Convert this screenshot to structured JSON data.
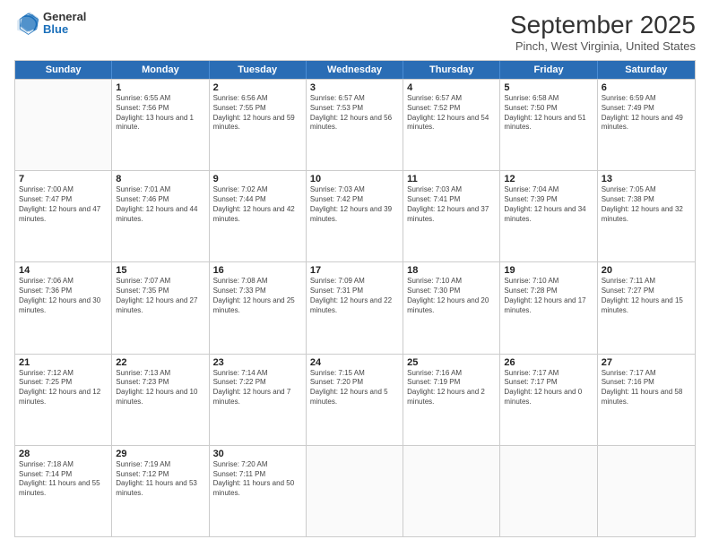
{
  "logo": {
    "general": "General",
    "blue": "Blue"
  },
  "title": "September 2025",
  "location": "Pinch, West Virginia, United States",
  "days": [
    "Sunday",
    "Monday",
    "Tuesday",
    "Wednesday",
    "Thursday",
    "Friday",
    "Saturday"
  ],
  "weeks": [
    [
      {
        "day": "",
        "sunrise": "",
        "sunset": "",
        "daylight": ""
      },
      {
        "day": "1",
        "sunrise": "Sunrise: 6:55 AM",
        "sunset": "Sunset: 7:56 PM",
        "daylight": "Daylight: 13 hours and 1 minute."
      },
      {
        "day": "2",
        "sunrise": "Sunrise: 6:56 AM",
        "sunset": "Sunset: 7:55 PM",
        "daylight": "Daylight: 12 hours and 59 minutes."
      },
      {
        "day": "3",
        "sunrise": "Sunrise: 6:57 AM",
        "sunset": "Sunset: 7:53 PM",
        "daylight": "Daylight: 12 hours and 56 minutes."
      },
      {
        "day": "4",
        "sunrise": "Sunrise: 6:57 AM",
        "sunset": "Sunset: 7:52 PM",
        "daylight": "Daylight: 12 hours and 54 minutes."
      },
      {
        "day": "5",
        "sunrise": "Sunrise: 6:58 AM",
        "sunset": "Sunset: 7:50 PM",
        "daylight": "Daylight: 12 hours and 51 minutes."
      },
      {
        "day": "6",
        "sunrise": "Sunrise: 6:59 AM",
        "sunset": "Sunset: 7:49 PM",
        "daylight": "Daylight: 12 hours and 49 minutes."
      }
    ],
    [
      {
        "day": "7",
        "sunrise": "Sunrise: 7:00 AM",
        "sunset": "Sunset: 7:47 PM",
        "daylight": "Daylight: 12 hours and 47 minutes."
      },
      {
        "day": "8",
        "sunrise": "Sunrise: 7:01 AM",
        "sunset": "Sunset: 7:46 PM",
        "daylight": "Daylight: 12 hours and 44 minutes."
      },
      {
        "day": "9",
        "sunrise": "Sunrise: 7:02 AM",
        "sunset": "Sunset: 7:44 PM",
        "daylight": "Daylight: 12 hours and 42 minutes."
      },
      {
        "day": "10",
        "sunrise": "Sunrise: 7:03 AM",
        "sunset": "Sunset: 7:42 PM",
        "daylight": "Daylight: 12 hours and 39 minutes."
      },
      {
        "day": "11",
        "sunrise": "Sunrise: 7:03 AM",
        "sunset": "Sunset: 7:41 PM",
        "daylight": "Daylight: 12 hours and 37 minutes."
      },
      {
        "day": "12",
        "sunrise": "Sunrise: 7:04 AM",
        "sunset": "Sunset: 7:39 PM",
        "daylight": "Daylight: 12 hours and 34 minutes."
      },
      {
        "day": "13",
        "sunrise": "Sunrise: 7:05 AM",
        "sunset": "Sunset: 7:38 PM",
        "daylight": "Daylight: 12 hours and 32 minutes."
      }
    ],
    [
      {
        "day": "14",
        "sunrise": "Sunrise: 7:06 AM",
        "sunset": "Sunset: 7:36 PM",
        "daylight": "Daylight: 12 hours and 30 minutes."
      },
      {
        "day": "15",
        "sunrise": "Sunrise: 7:07 AM",
        "sunset": "Sunset: 7:35 PM",
        "daylight": "Daylight: 12 hours and 27 minutes."
      },
      {
        "day": "16",
        "sunrise": "Sunrise: 7:08 AM",
        "sunset": "Sunset: 7:33 PM",
        "daylight": "Daylight: 12 hours and 25 minutes."
      },
      {
        "day": "17",
        "sunrise": "Sunrise: 7:09 AM",
        "sunset": "Sunset: 7:31 PM",
        "daylight": "Daylight: 12 hours and 22 minutes."
      },
      {
        "day": "18",
        "sunrise": "Sunrise: 7:10 AM",
        "sunset": "Sunset: 7:30 PM",
        "daylight": "Daylight: 12 hours and 20 minutes."
      },
      {
        "day": "19",
        "sunrise": "Sunrise: 7:10 AM",
        "sunset": "Sunset: 7:28 PM",
        "daylight": "Daylight: 12 hours and 17 minutes."
      },
      {
        "day": "20",
        "sunrise": "Sunrise: 7:11 AM",
        "sunset": "Sunset: 7:27 PM",
        "daylight": "Daylight: 12 hours and 15 minutes."
      }
    ],
    [
      {
        "day": "21",
        "sunrise": "Sunrise: 7:12 AM",
        "sunset": "Sunset: 7:25 PM",
        "daylight": "Daylight: 12 hours and 12 minutes."
      },
      {
        "day": "22",
        "sunrise": "Sunrise: 7:13 AM",
        "sunset": "Sunset: 7:23 PM",
        "daylight": "Daylight: 12 hours and 10 minutes."
      },
      {
        "day": "23",
        "sunrise": "Sunrise: 7:14 AM",
        "sunset": "Sunset: 7:22 PM",
        "daylight": "Daylight: 12 hours and 7 minutes."
      },
      {
        "day": "24",
        "sunrise": "Sunrise: 7:15 AM",
        "sunset": "Sunset: 7:20 PM",
        "daylight": "Daylight: 12 hours and 5 minutes."
      },
      {
        "day": "25",
        "sunrise": "Sunrise: 7:16 AM",
        "sunset": "Sunset: 7:19 PM",
        "daylight": "Daylight: 12 hours and 2 minutes."
      },
      {
        "day": "26",
        "sunrise": "Sunrise: 7:17 AM",
        "sunset": "Sunset: 7:17 PM",
        "daylight": "Daylight: 12 hours and 0 minutes."
      },
      {
        "day": "27",
        "sunrise": "Sunrise: 7:17 AM",
        "sunset": "Sunset: 7:16 PM",
        "daylight": "Daylight: 11 hours and 58 minutes."
      }
    ],
    [
      {
        "day": "28",
        "sunrise": "Sunrise: 7:18 AM",
        "sunset": "Sunset: 7:14 PM",
        "daylight": "Daylight: 11 hours and 55 minutes."
      },
      {
        "day": "29",
        "sunrise": "Sunrise: 7:19 AM",
        "sunset": "Sunset: 7:12 PM",
        "daylight": "Daylight: 11 hours and 53 minutes."
      },
      {
        "day": "30",
        "sunrise": "Sunrise: 7:20 AM",
        "sunset": "Sunset: 7:11 PM",
        "daylight": "Daylight: 11 hours and 50 minutes."
      },
      {
        "day": "",
        "sunrise": "",
        "sunset": "",
        "daylight": ""
      },
      {
        "day": "",
        "sunrise": "",
        "sunset": "",
        "daylight": ""
      },
      {
        "day": "",
        "sunrise": "",
        "sunset": "",
        "daylight": ""
      },
      {
        "day": "",
        "sunrise": "",
        "sunset": "",
        "daylight": ""
      }
    ]
  ]
}
